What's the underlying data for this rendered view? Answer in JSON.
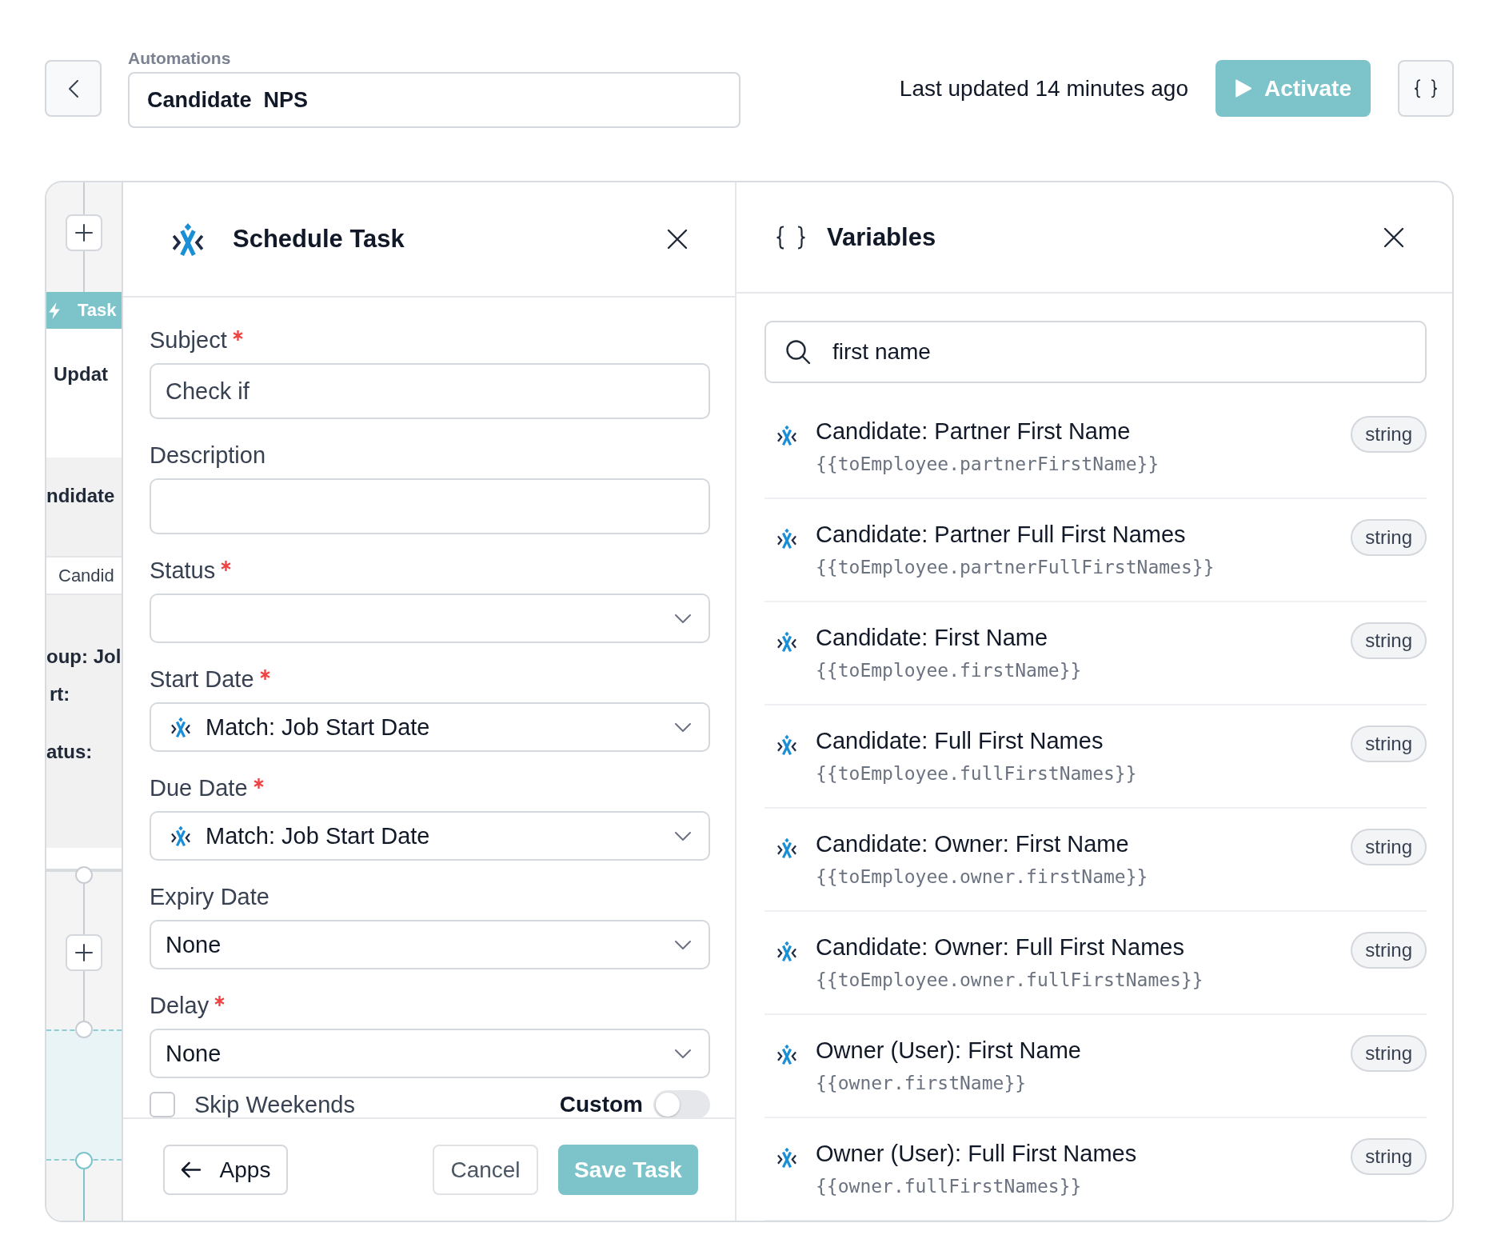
{
  "header": {
    "breadcrumb": "Automations",
    "name": "Candidate  NPS",
    "last_updated": "Last updated 14 minutes ago",
    "activate_label": "Activate"
  },
  "canvas": {
    "nodes": [
      {
        "kind": "task",
        "badge": "Task",
        "title": "Updat"
      },
      {
        "kind": "condition",
        "title": "ndidate",
        "chip": "Candid",
        "details": [
          "oup: Jol",
          "rt:",
          "atus:"
        ]
      }
    ]
  },
  "task_panel": {
    "title": "Schedule Task",
    "fields": [
      {
        "kind": "text",
        "label": "Subject",
        "required": true,
        "value": "Check if"
      },
      {
        "kind": "text",
        "label": "Description",
        "required": false
      },
      {
        "kind": "select",
        "label": "Status",
        "required": true
      },
      {
        "kind": "select",
        "label": "Start Date",
        "required": true,
        "variable": true,
        "value": "Match: Job Start Date"
      },
      {
        "kind": "select",
        "label": "Due Date",
        "required": true,
        "variable": true,
        "value": "Match: Job Start Date"
      },
      {
        "kind": "select",
        "label": "Expiry Date",
        "required": false,
        "variable": false,
        "value": "None"
      },
      {
        "kind": "select",
        "label": "Delay",
        "required": true,
        "variable": false,
        "value": "None"
      }
    ],
    "skip_weekends": {
      "label": "Skip Weekends",
      "checked": false
    },
    "custom": {
      "label": "Custom",
      "on": false
    },
    "buttons": [
      {
        "kind": "back",
        "label": "Apps"
      },
      {
        "kind": "secondary",
        "label": "Cancel"
      },
      {
        "kind": "primary",
        "label": "Save Task"
      }
    ]
  },
  "variables_panel": {
    "title": "Variables",
    "search": {
      "value": "first name"
    },
    "items": [
      {
        "name": "Candidate: Partner First Name",
        "path": "{{toEmployee.partnerFirstName}}",
        "type": "string"
      },
      {
        "name": "Candidate: Partner Full First Names",
        "path": "{{toEmployee.partnerFullFirstNames}}",
        "type": "string"
      },
      {
        "name": "Candidate: First Name",
        "path": "{{toEmployee.firstName}}",
        "type": "string"
      },
      {
        "name": "Candidate: Full First Names",
        "path": "{{toEmployee.fullFirstNames}}",
        "type": "string"
      },
      {
        "name": "Candidate: Owner: First Name",
        "path": "{{toEmployee.owner.firstName}}",
        "type": "string"
      },
      {
        "name": "Candidate: Owner: Full First Names",
        "path": "{{toEmployee.owner.fullFirstNames}}",
        "type": "string"
      },
      {
        "name": "Owner (User): First Name",
        "path": "{{owner.firstName}}",
        "type": "string"
      },
      {
        "name": "Owner (User): Full First Names",
        "path": "{{owner.fullFirstNames}}",
        "type": "string"
      }
    ]
  }
}
